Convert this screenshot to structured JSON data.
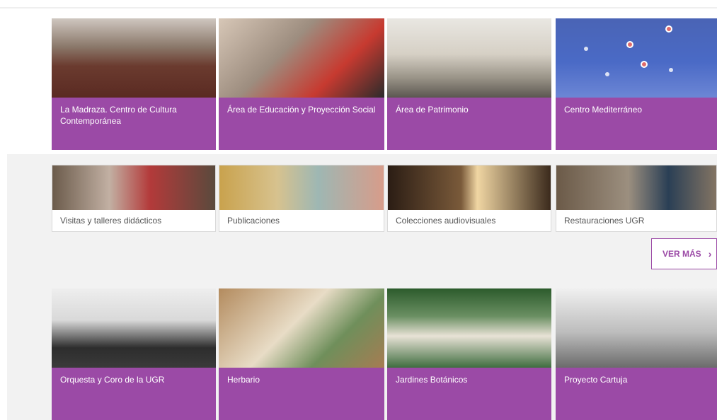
{
  "featured": [
    {
      "title": "La Madraza. Centro de Cultura Contemporánea",
      "image_icon": "conference-photo-icon"
    },
    {
      "title": "Área de Educación y Proyección Social",
      "image_icon": "hands-photo-icon"
    },
    {
      "title": "Área de Patrimonio",
      "image_icon": "courtyard-photo-icon"
    },
    {
      "title": "Centro Mediterráneo",
      "image_icon": "map-photo-icon"
    }
  ],
  "small_cards": [
    {
      "title": "Visitas y talleres didácticos",
      "image_icon": "gallery-visit-photo-icon"
    },
    {
      "title": "Publicaciones",
      "image_icon": "painting-photo-icon"
    },
    {
      "title": "Colecciones audiovisuales",
      "image_icon": "avenue-photo-icon"
    },
    {
      "title": "Restauraciones UGR",
      "image_icon": "restoration-photo-icon"
    }
  ],
  "ver_mas": {
    "label": "VER MÁS",
    "icon": "chevron-right-icon"
  },
  "bottom": [
    {
      "title": "Orquesta y Coro de la UGR",
      "image_icon": "orchestra-photo-icon"
    },
    {
      "title": "Herbario",
      "image_icon": "herbarium-photo-icon"
    },
    {
      "title": "Jardines Botánicos",
      "image_icon": "garden-gate-photo-icon"
    },
    {
      "title": "Proyecto Cartuja",
      "image_icon": "cartuja-photo-icon"
    }
  ],
  "colors": {
    "accent": "#9b4aa6",
    "background_band": "#f2f2f2"
  }
}
